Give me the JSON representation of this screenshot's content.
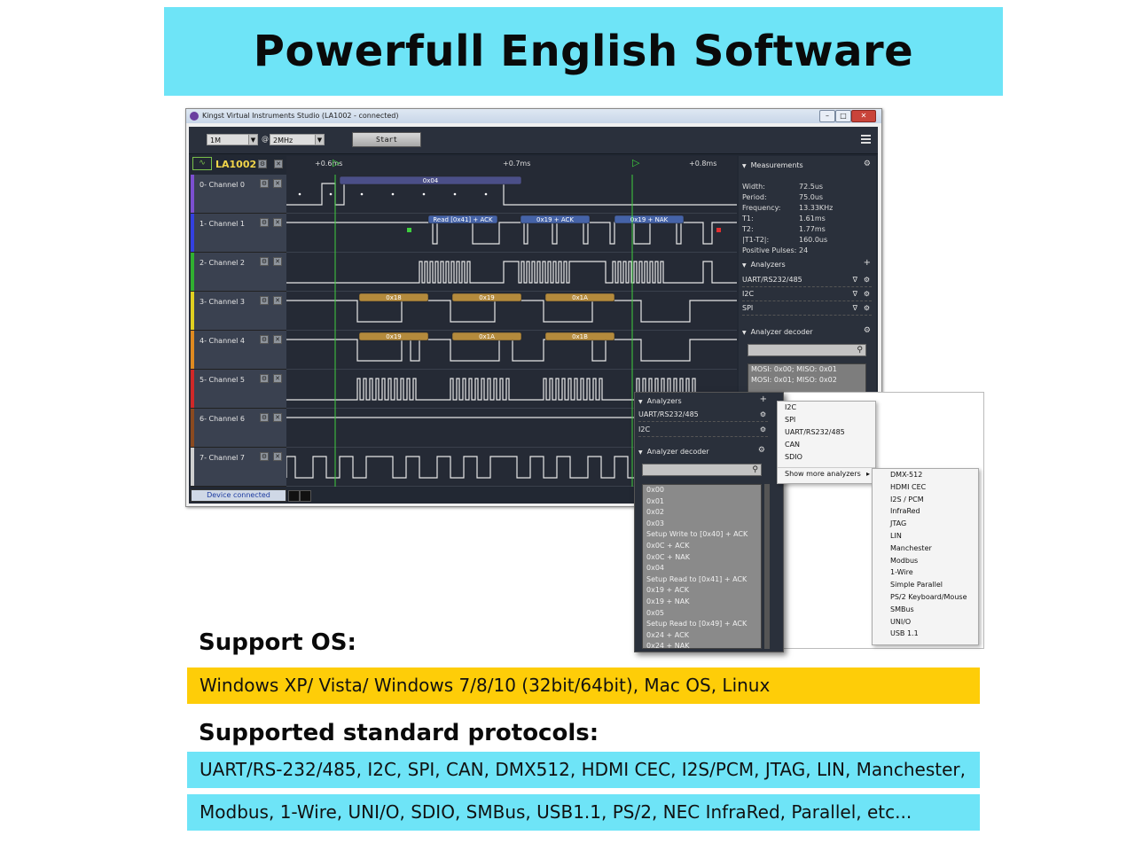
{
  "banner": {
    "title": "Powerfull English Software"
  },
  "window": {
    "title": "Kingst Virtual Instruments Studio (LA1002 - connected)",
    "samples": "1M",
    "at": "@",
    "rate": "2MHz",
    "start_label": "Start",
    "device": "LA1002",
    "status": "Device connected",
    "ruler": [
      "+0.6ms",
      "+0.7ms",
      "+0.8ms"
    ],
    "channels": [
      "0- Channel 0",
      "1- Channel 1",
      "2- Channel 2",
      "3- Channel 3",
      "4- Channel 4",
      "5- Channel 5",
      "6- Channel 6",
      "7- Channel 7"
    ],
    "channel_colors": [
      "#7c4fd0",
      "#3340e0",
      "#30b030",
      "#e0d020",
      "#e08a20",
      "#d02828",
      "#8a4a20",
      "#cfcfcf"
    ],
    "decode_labels": {
      "ch0": [
        "0x04"
      ],
      "ch1": [
        "Read [0x41] + ACK",
        "0x19 + ACK",
        "0x19 + NAK"
      ],
      "ch3": [
        "0x18",
        "0x19",
        "0x1A"
      ],
      "ch4": [
        "0x19",
        "0x1A",
        "0x1B"
      ]
    },
    "markers": [
      "1",
      "2"
    ]
  },
  "measurements": {
    "title": "Measurements",
    "rows": [
      {
        "k": "Width:",
        "v": "72.5us"
      },
      {
        "k": "Period:",
        "v": "75.0us"
      },
      {
        "k": "Frequency:",
        "v": "13.33KHz"
      },
      {
        "k": "T1:",
        "v": "1.61ms"
      },
      {
        "k": "T2:",
        "v": "1.77ms"
      },
      {
        "k": "|T1-T2|:",
        "v": "160.0us"
      },
      {
        "k": "Positive Pulses:",
        "v": "24"
      }
    ]
  },
  "analyzers": {
    "title": "Analyzers",
    "items": [
      "UART/RS232/485",
      "I2C",
      "SPI"
    ]
  },
  "decoder": {
    "title": "Analyzer decoder",
    "rows": [
      "MOSI: 0x00;  MISO: 0x01",
      "MOSI: 0x01;  MISO: 0x02"
    ]
  },
  "overlay": {
    "analyzers_title": "Analyzers",
    "items": [
      "UART/RS232/485",
      "I2C"
    ],
    "decoder_title": "Analyzer decoder",
    "list": [
      "0x00",
      "0x01",
      "0x02",
      "0x03",
      "Setup Write to [0x40] + ACK",
      "0x0C + ACK",
      "0x0C + NAK",
      "0x04",
      "Setup Read to [0x41] + ACK",
      "0x19 + ACK",
      "0x19 + NAK",
      "0x05",
      "Setup Read to [0x49] + ACK",
      "0x24 + ACK",
      "0x24 + NAK"
    ],
    "menu1": [
      "I2C",
      "SPI",
      "UART/RS232/485",
      "CAN",
      "SDIO",
      "Show more analyzers"
    ],
    "menu2": [
      "DMX-512",
      "HDMI CEC",
      "I2S / PCM",
      "InfraRed",
      "JTAG",
      "LIN",
      "Manchester",
      "Modbus",
      "1-Wire",
      "Simple Parallel",
      "PS/2 Keyboard/Mouse",
      "SMBus",
      "UNI/O",
      "USB 1.1"
    ]
  },
  "support_os": {
    "heading": "Support OS:",
    "text": "Windows XP/ Vista/ Windows 7/8/10 (32bit/64bit), Mac OS, Linux"
  },
  "protocols": {
    "heading": "Supported standard protocols:",
    "line1": "UART/RS-232/485, I2C, SPI, CAN, DMX512, HDMI CEC, I2S/PCM, JTAG, LIN, Manchester,",
    "line2": "Modbus, 1-Wire, UNI/O, SDIO, SMBus, USB1.1, PS/2, NEC InfraRed, Parallel, etc..."
  }
}
